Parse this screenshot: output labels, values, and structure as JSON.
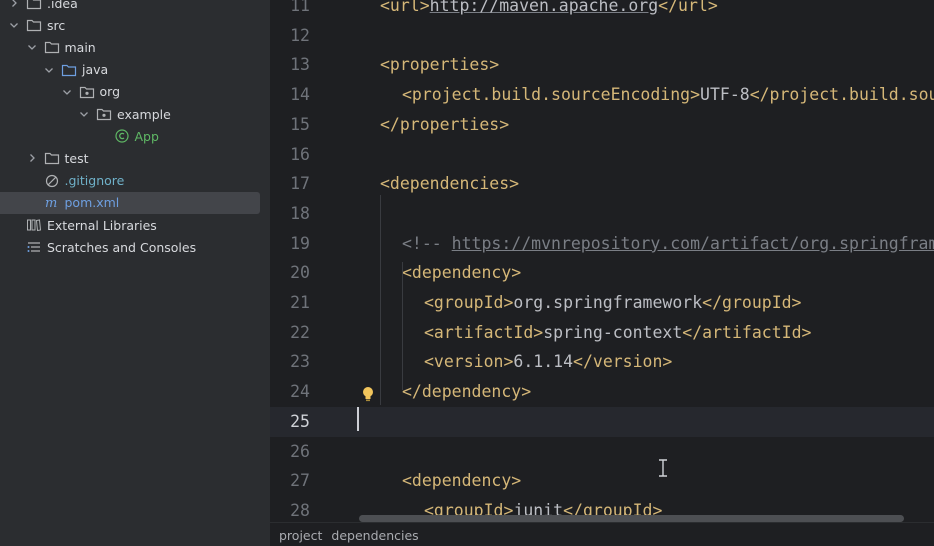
{
  "tree": {
    "items": [
      {
        "label": ".idea",
        "depth": 0,
        "kind": "folder",
        "expanded": false
      },
      {
        "label": "src",
        "depth": 0,
        "kind": "folder",
        "expanded": true
      },
      {
        "label": "main",
        "depth": 1,
        "kind": "folder",
        "expanded": true
      },
      {
        "label": "java",
        "depth": 2,
        "kind": "source-folder",
        "expanded": true
      },
      {
        "label": "org",
        "depth": 3,
        "kind": "package",
        "expanded": true
      },
      {
        "label": "example",
        "depth": 4,
        "kind": "package",
        "expanded": true
      },
      {
        "label": "App",
        "depth": 5,
        "kind": "class",
        "expanded": false
      },
      {
        "label": "test",
        "depth": 1,
        "kind": "folder",
        "expanded": false
      },
      {
        "label": ".gitignore",
        "depth": 1,
        "kind": "ignored-file",
        "expanded": false
      },
      {
        "label": "pom.xml",
        "depth": 1,
        "kind": "maven-file",
        "expanded": false,
        "selected": true
      },
      {
        "label": "External Libraries",
        "depth": 0,
        "kind": "libraries",
        "expanded": false
      },
      {
        "label": "Scratches and Consoles",
        "depth": 0,
        "kind": "scratches",
        "expanded": false
      }
    ]
  },
  "editor": {
    "current_line": 25,
    "lines": [
      {
        "n": "11",
        "segs": [
          [
            "tag",
            "<url>"
          ],
          [
            "url",
            "http://maven.apache.org"
          ],
          [
            "tag",
            "</url>"
          ]
        ],
        "indent": 1
      },
      {
        "n": "12",
        "segs": [],
        "indent": 0
      },
      {
        "n": "13",
        "segs": [
          [
            "tag",
            "<properties>"
          ]
        ],
        "indent": 1
      },
      {
        "n": "14",
        "segs": [
          [
            "tag",
            "<project.build.sourceEncoding>"
          ],
          [
            "txt",
            "UTF-8"
          ],
          [
            "tag",
            "</project.build.sourceEncoding>"
          ]
        ],
        "indent": 2
      },
      {
        "n": "15",
        "segs": [
          [
            "tag",
            "</properties>"
          ]
        ],
        "indent": 1
      },
      {
        "n": "16",
        "segs": [],
        "indent": 0
      },
      {
        "n": "17",
        "segs": [
          [
            "tag",
            "<dependencies>"
          ]
        ],
        "indent": 1
      },
      {
        "n": "18",
        "segs": [],
        "indent": 0
      },
      {
        "n": "19",
        "segs": [
          [
            "cmt",
            "<!-- "
          ],
          [
            "cmt-url",
            "https://mvnrepository.com/artifact/org.springframework/spring-context"
          ],
          [
            "cmt",
            " -->"
          ]
        ],
        "indent": 2
      },
      {
        "n": "20",
        "segs": [
          [
            "tag",
            "<dependency>"
          ]
        ],
        "indent": 2
      },
      {
        "n": "21",
        "segs": [
          [
            "tag",
            "<groupId>"
          ],
          [
            "txt",
            "org.springframework"
          ],
          [
            "tag",
            "</groupId>"
          ]
        ],
        "indent": 3
      },
      {
        "n": "22",
        "segs": [
          [
            "tag",
            "<artifactId>"
          ],
          [
            "txt",
            "spring-context"
          ],
          [
            "tag",
            "</artifactId>"
          ]
        ],
        "indent": 3
      },
      {
        "n": "23",
        "segs": [
          [
            "tag",
            "<version>"
          ],
          [
            "txt",
            "6.1.14"
          ],
          [
            "tag",
            "</version>"
          ]
        ],
        "indent": 3
      },
      {
        "n": "24",
        "segs": [
          [
            "tag",
            "</dependency>"
          ]
        ],
        "indent": 2
      },
      {
        "n": "25",
        "segs": [],
        "indent": 0
      },
      {
        "n": "26",
        "segs": [],
        "indent": 0
      },
      {
        "n": "27",
        "segs": [
          [
            "tag",
            "<dependency>"
          ]
        ],
        "indent": 2
      },
      {
        "n": "28",
        "segs": [
          [
            "tag",
            "<groupId>"
          ],
          [
            "txt",
            "junit"
          ],
          [
            "tag",
            "</groupId>"
          ]
        ],
        "indent": 3
      }
    ]
  },
  "breadcrumbs": [
    "project",
    "dependencies"
  ],
  "colors": {
    "xml_tag": "#d5b778",
    "text": "#bcbec4",
    "comment": "#7a7e85",
    "selected_file": "#6e9fe0",
    "class_name": "#5fb865"
  }
}
